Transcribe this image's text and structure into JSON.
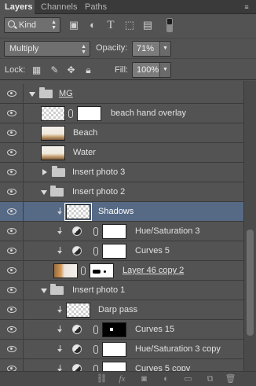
{
  "tabs": [
    {
      "label": "Layers"
    },
    {
      "label": "Channels"
    },
    {
      "label": "Paths"
    }
  ],
  "filter": {
    "kind_label": "Kind",
    "icons": [
      "image-filter-icon",
      "adjustment-filter-icon",
      "type-filter-icon",
      "shape-filter-icon",
      "smart-object-filter-icon"
    ]
  },
  "blend": {
    "mode": "Multiply",
    "opacity_label": "Opacity:",
    "opacity_value": "71%",
    "lock_label": "Lock:",
    "fill_label": "Fill:",
    "fill_value": "100%"
  },
  "layers": [
    {
      "name": "MG",
      "type": "group",
      "expanded": true
    },
    {
      "name": "beach hand overlay",
      "type": "layer-mask"
    },
    {
      "name": "Beach",
      "type": "layer"
    },
    {
      "name": "Water",
      "type": "layer"
    },
    {
      "name": "Insert photo 3",
      "type": "group",
      "expanded": false
    },
    {
      "name": "Insert photo 2",
      "type": "group",
      "expanded": true
    },
    {
      "name": "Shadows",
      "type": "layer",
      "selected": true
    },
    {
      "name": "Hue/Saturation 3",
      "type": "adjustment"
    },
    {
      "name": "Curves 5",
      "type": "adjustment"
    },
    {
      "name": "Layer 46 copy 2",
      "type": "layer-mask"
    },
    {
      "name": "Insert photo 1",
      "type": "group",
      "expanded": true
    },
    {
      "name": "Darp pass",
      "type": "layer"
    },
    {
      "name": "Curves 15",
      "type": "adjustment"
    },
    {
      "name": "Hue/Saturation 3 copy",
      "type": "adjustment"
    },
    {
      "name": "Curves 5 copy",
      "type": "adjustment"
    }
  ],
  "bottom_icons": [
    "link-layers-icon",
    "fx-icon",
    "add-mask-icon",
    "new-adjustment-icon",
    "new-group-icon",
    "new-layer-icon",
    "delete-layer-icon"
  ]
}
